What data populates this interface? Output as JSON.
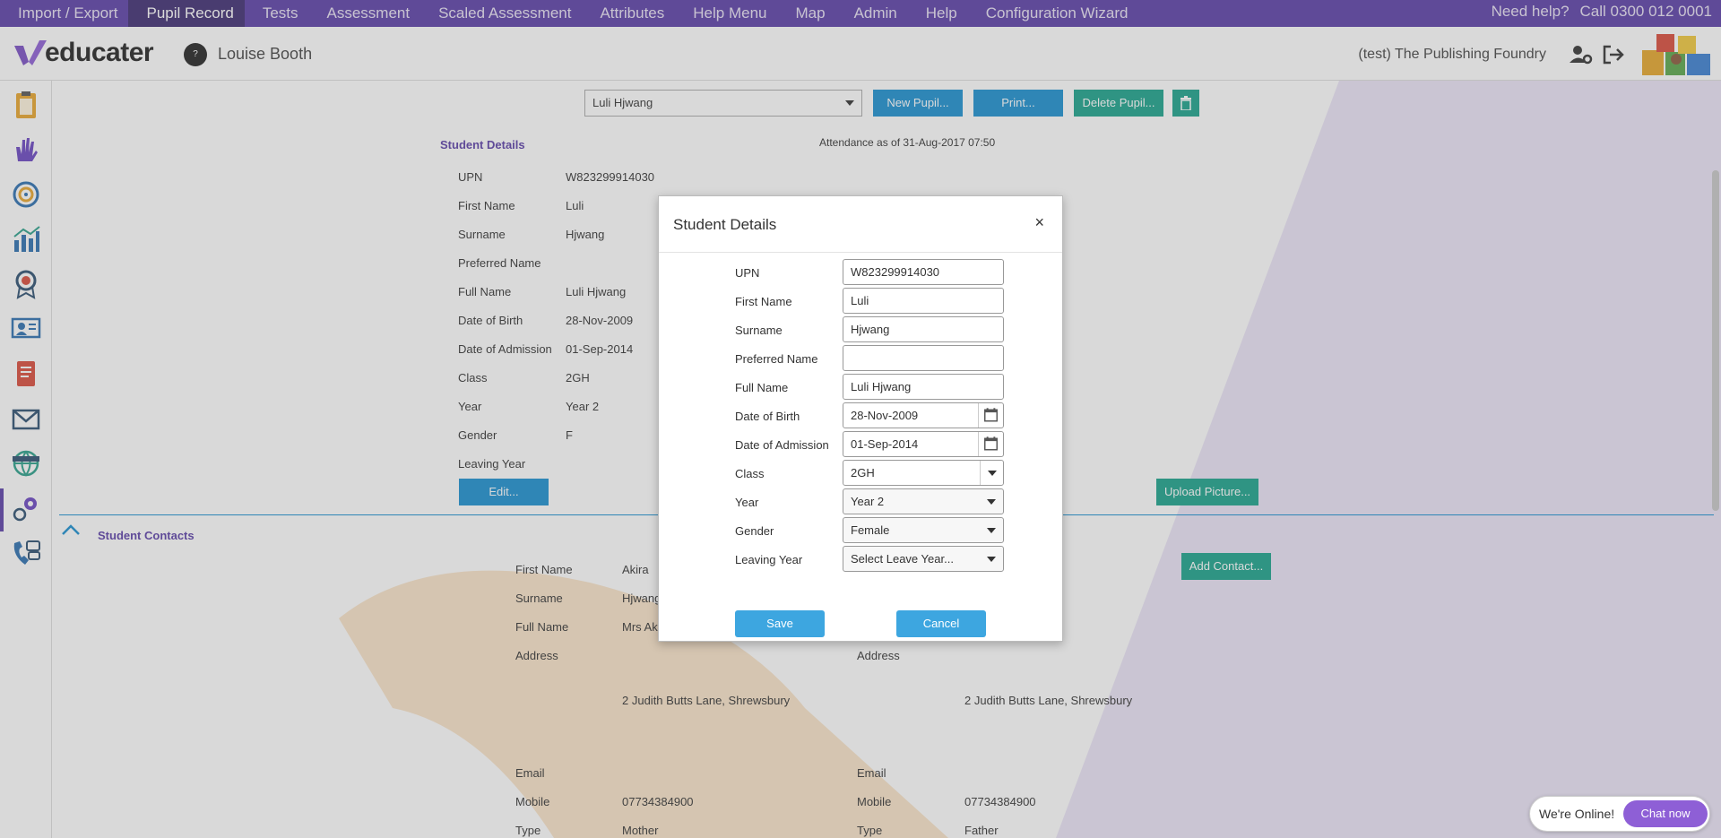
{
  "topnav": {
    "items": [
      "Import / Export",
      "Pupil Record",
      "Tests",
      "Assessment",
      "Scaled Assessment",
      "Attributes",
      "Help Menu",
      "Map",
      "Admin",
      "Help",
      "Configuration Wizard"
    ],
    "active_index": 1,
    "need_help": "Need help?",
    "phone": "Call 0300 012 0001"
  },
  "header": {
    "logo_text": "educater",
    "avatar_text": "?",
    "user_name": "Louise Booth",
    "school": "(test) The Publishing Foundry"
  },
  "sidebar": {
    "icons": [
      "clipboard-icon",
      "hand-icon",
      "target-icon",
      "bar-chart-icon",
      "award-icon",
      "presentation-icon",
      "report-book-icon",
      "mail-icon",
      "globe-icon",
      "settings-gears-icon",
      "contacts-icon"
    ]
  },
  "toolbar": {
    "pupil_select": "Luli Hjwang",
    "new_pupil": "New Pupil...",
    "print": "Print...",
    "delete_pupil": "Delete Pupil..."
  },
  "student_details": {
    "title": "Student Details",
    "attendance": "Attendance as of 31-Aug-2017 07:50",
    "fields": [
      {
        "label": "UPN",
        "value": "W823299914030"
      },
      {
        "label": "First Name",
        "value": "Luli"
      },
      {
        "label": "Surname",
        "value": "Hjwang"
      },
      {
        "label": "Preferred Name",
        "value": ""
      },
      {
        "label": "Full Name",
        "value": "Luli Hjwang"
      },
      {
        "label": "Date of Birth",
        "value": "28-Nov-2009"
      },
      {
        "label": "Date of Admission",
        "value": "01-Sep-2014"
      },
      {
        "label": "Class",
        "value": "2GH"
      },
      {
        "label": "Year",
        "value": "Year 2"
      },
      {
        "label": "Gender",
        "value": "F"
      },
      {
        "label": "Leaving Year",
        "value": ""
      }
    ],
    "edit_button": "Edit...",
    "upload_button": "Upload Picture..."
  },
  "contacts": {
    "title": "Student Contacts",
    "add_contact": "Add Contact...",
    "left": {
      "first_name_label": "First Name",
      "first_name": "Akira",
      "surname_label": "Surname",
      "surname": "Hjwang",
      "full_name_label": "Full Name",
      "full_name": "Mrs Aki",
      "address_label": "Address",
      "address": "2 Judith Butts Lane, Shrewsbury",
      "email_label": "Email",
      "mobile_label": "Mobile",
      "mobile": "07734384900",
      "type_label": "Type",
      "type": "Mother"
    },
    "right": {
      "address_label": "Address",
      "address": "2 Judith Butts Lane, Shrewsbury",
      "email_label": "Email",
      "mobile_label": "Mobile",
      "mobile": "07734384900",
      "type_label": "Type",
      "type": "Father"
    }
  },
  "modal": {
    "title": "Student Details",
    "close": "×",
    "fields": [
      {
        "label": "UPN",
        "value": "W823299914030",
        "kind": "text"
      },
      {
        "label": "First Name",
        "value": "Luli",
        "kind": "text"
      },
      {
        "label": "Surname",
        "value": "Hjwang",
        "kind": "text"
      },
      {
        "label": "Preferred Name",
        "value": "",
        "kind": "text"
      },
      {
        "label": "Full Name",
        "value": "Luli Hjwang",
        "kind": "text"
      },
      {
        "label": "Date of Birth",
        "value": "28-Nov-2009",
        "kind": "date"
      },
      {
        "label": "Date of Admission",
        "value": "01-Sep-2014",
        "kind": "date"
      },
      {
        "label": "Class",
        "value": "2GH",
        "kind": "select"
      },
      {
        "label": "Year",
        "value": "Year 2",
        "kind": "select"
      },
      {
        "label": "Gender",
        "value": "Female",
        "kind": "select"
      },
      {
        "label": "Leaving Year",
        "value": "Select Leave Year...",
        "kind": "select"
      }
    ],
    "save": "Save",
    "cancel": "Cancel"
  },
  "chat": {
    "status": "We're Online!",
    "button": "Chat now"
  },
  "colors": {
    "nav": "#5b3fa8",
    "blue_button": "#1a8fd0",
    "green_button": "#1aa38c",
    "modal_button": "#3da6e0",
    "chat_button": "#8e5fd6"
  }
}
